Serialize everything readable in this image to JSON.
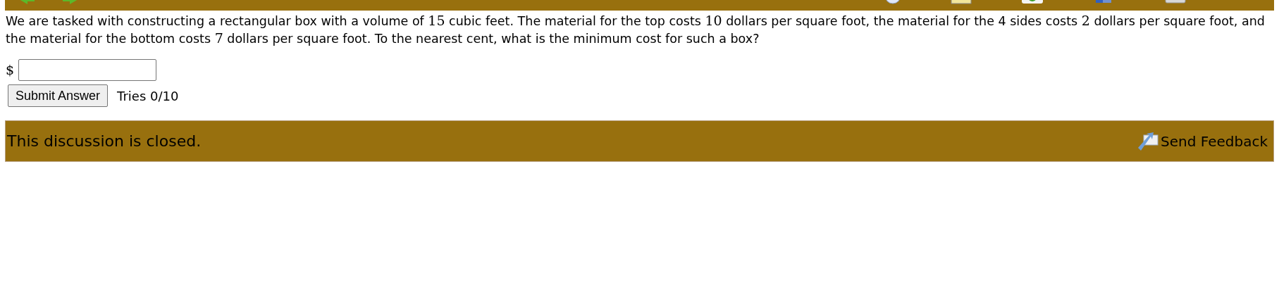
{
  "question": {
    "parts": [
      {
        "kind": "text",
        "text": "We are tasked with constructing a rectangular box with a volume of "
      },
      {
        "kind": "math",
        "text": "15"
      },
      {
        "kind": "text",
        "text": " cubic feet. The material for the top costs "
      },
      {
        "kind": "math",
        "text": "10"
      },
      {
        "kind": "text",
        "text": " dollars per square foot, the material for the 4 sides costs "
      },
      {
        "kind": "math",
        "text": "2"
      },
      {
        "kind": "text",
        "text": " dollars per square foot, and the material for the bottom costs "
      },
      {
        "kind": "math",
        "text": "7"
      },
      {
        "kind": "text",
        "text": " dollars per square foot. To the nearest cent, what is the minimum cost for such a box?"
      }
    ]
  },
  "answer": {
    "prefix": "$",
    "submit": "Submit Answer",
    "tries": "Tries 0/10"
  },
  "discussion": {
    "status": "This discussion is closed.",
    "feedback": "Send Feedback"
  }
}
